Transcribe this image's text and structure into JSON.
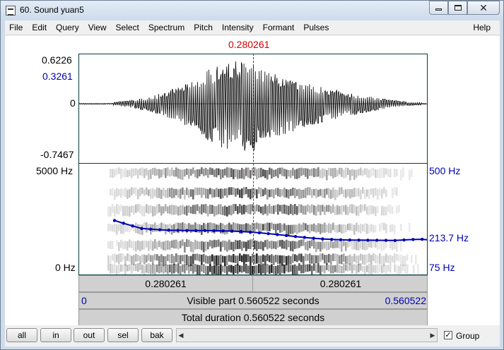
{
  "window": {
    "title": "60. Sound yuan5",
    "close_glyph": "✕"
  },
  "menu": [
    "File",
    "Edit",
    "Query",
    "View",
    "Select",
    "Spectrum",
    "Pitch",
    "Intensity",
    "Formant",
    "Pulses"
  ],
  "menu_help": "Help",
  "cursor_time": "0.280261",
  "waveform": {
    "max_label": "0.6226",
    "cursor_value": "0.3261",
    "zero_label": "0",
    "min_label": "-0.7467"
  },
  "spectrogram": {
    "top_freq": "5000 Hz",
    "bottom_freq": "0 Hz"
  },
  "pitch": {
    "top_label": "500 Hz",
    "value_label": "213.7 Hz",
    "bottom_label": "75 Hz",
    "color": "#0000b4"
  },
  "time_bar": {
    "left": "0.280261",
    "right": "0.280261"
  },
  "visible_bar": {
    "start": "0",
    "text": "Visible part 0.560522 seconds",
    "end": "0.560522"
  },
  "total_bar": {
    "text": "Total duration 0.560522 seconds"
  },
  "toolbar": {
    "buttons": [
      "all",
      "in",
      "out",
      "sel",
      "bak"
    ],
    "scroll_left": "◀",
    "scroll_right": "▶",
    "group_label": "Group",
    "group_check": "✓"
  }
}
